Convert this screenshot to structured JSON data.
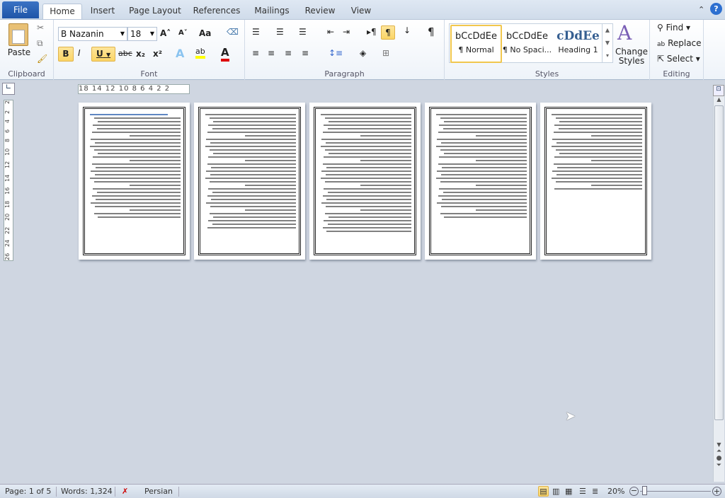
{
  "tabs": [
    "File",
    "Home",
    "Insert",
    "Page Layout",
    "References",
    "Mailings",
    "Review",
    "View"
  ],
  "clipboard": {
    "paste": "Paste",
    "label": "Clipboard"
  },
  "font": {
    "name": "B Nazanin",
    "size": "18",
    "label": "Font",
    "bold": "B",
    "italic": "I",
    "underline": "U",
    "strike": "abc",
    "sub": "x₂",
    "sup": "x²",
    "grow": "A˄",
    "shrink": "A˅",
    "case": "Aa"
  },
  "paragraph": {
    "label": "Paragraph"
  },
  "styles": {
    "label": "Styles",
    "items": [
      {
        "preview": "bCcDdEe",
        "name": "¶ Normal"
      },
      {
        "preview": "bCcDdEe",
        "name": "¶ No Spaci..."
      },
      {
        "preview": "cDdEe",
        "name": "Heading 1"
      }
    ],
    "change": "Change Styles"
  },
  "editing": {
    "label": "Editing",
    "find": "Find",
    "replace": "Replace",
    "select": "Select"
  },
  "ruler": "18   14 12 10  8  6  4  2      2",
  "vruler": [
    "2",
    "2",
    "4",
    "6",
    "8",
    "10",
    "12",
    "14",
    "16",
    "18",
    "20",
    "22",
    "24",
    "26"
  ],
  "status": {
    "page": "Page: 1 of 5",
    "words": "Words: 1,324",
    "language": "Persian",
    "zoom": "20%"
  },
  "zoom_level_percent": 20,
  "accent": "#2a5fae"
}
